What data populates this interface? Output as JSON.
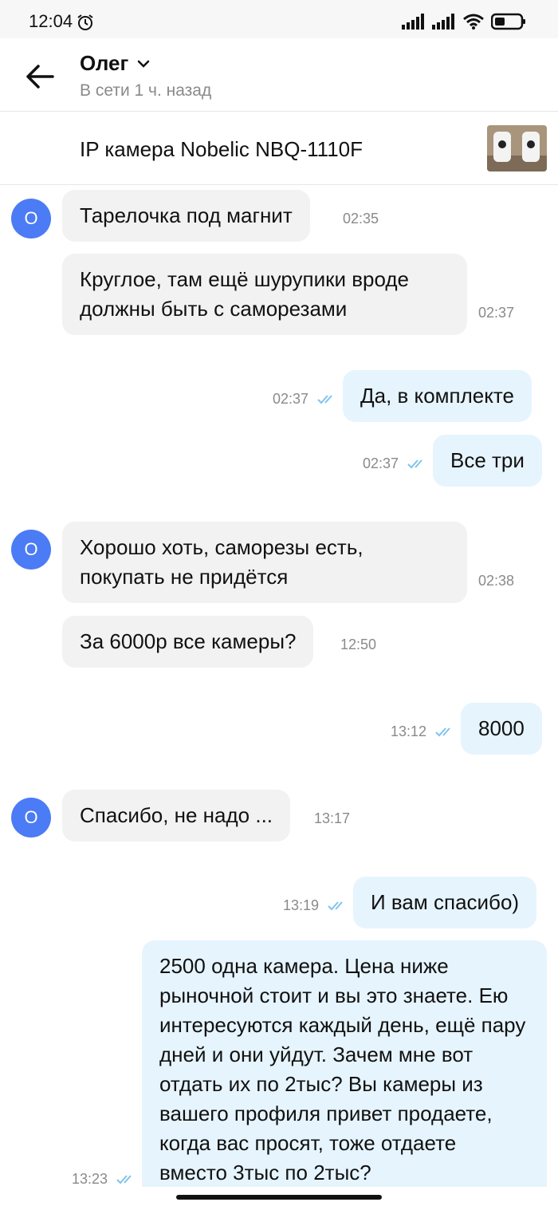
{
  "status_bar": {
    "time": "12:04",
    "icons": [
      "alarm-icon",
      "signal-icon",
      "signal-icon",
      "wifi-icon",
      "battery-icon"
    ]
  },
  "header": {
    "contact_name": "Олег",
    "status": "В сети 1 ч. назад",
    "icons": [
      "back-arrow-icon",
      "chevron-down-icon"
    ]
  },
  "listing": {
    "title": "IP камера Nobelic NBQ-1110F"
  },
  "avatar_letter": "О",
  "messages": [
    {
      "text": "Тарелочка под магнит",
      "time": "02:35"
    },
    {
      "text": "Круглое, там ещё шурупики вроде должны быть с саморезами",
      "time": "02:37"
    },
    {
      "text": "Да, в комплекте",
      "time": "02:37"
    },
    {
      "text": "Все три",
      "time": "02:37"
    },
    {
      "text": "Хорошо хоть, саморезы есть, покупать не придётся",
      "time": "02:38"
    },
    {
      "text": "За 6000р все камеры?",
      "time": "12:50"
    },
    {
      "text": "8000",
      "time": "13:12"
    },
    {
      "text": "Спасибо, не надо ...",
      "time": "13:17"
    },
    {
      "text": "И вам спасибо)",
      "time": "13:19"
    },
    {
      "text": "2500 одна камера. Цена ниже рыночной стоит и вы это знаете. Ею интересуются каждый день, ещё пару дней и они уйдут. Зачем мне вот отдать их по 2тыс? Вы камеры из вашего профиля привет продаете, когда вас просят, тоже отдаете вместо 3тыс по 2тыс?",
      "time": "13:23"
    }
  ],
  "colors": {
    "avatar": "#4b7bf5",
    "incoming_bubble": "#f2f2f2",
    "outgoing_bubble": "#e6f4fd",
    "read_ticks": "#7fc4ee"
  }
}
